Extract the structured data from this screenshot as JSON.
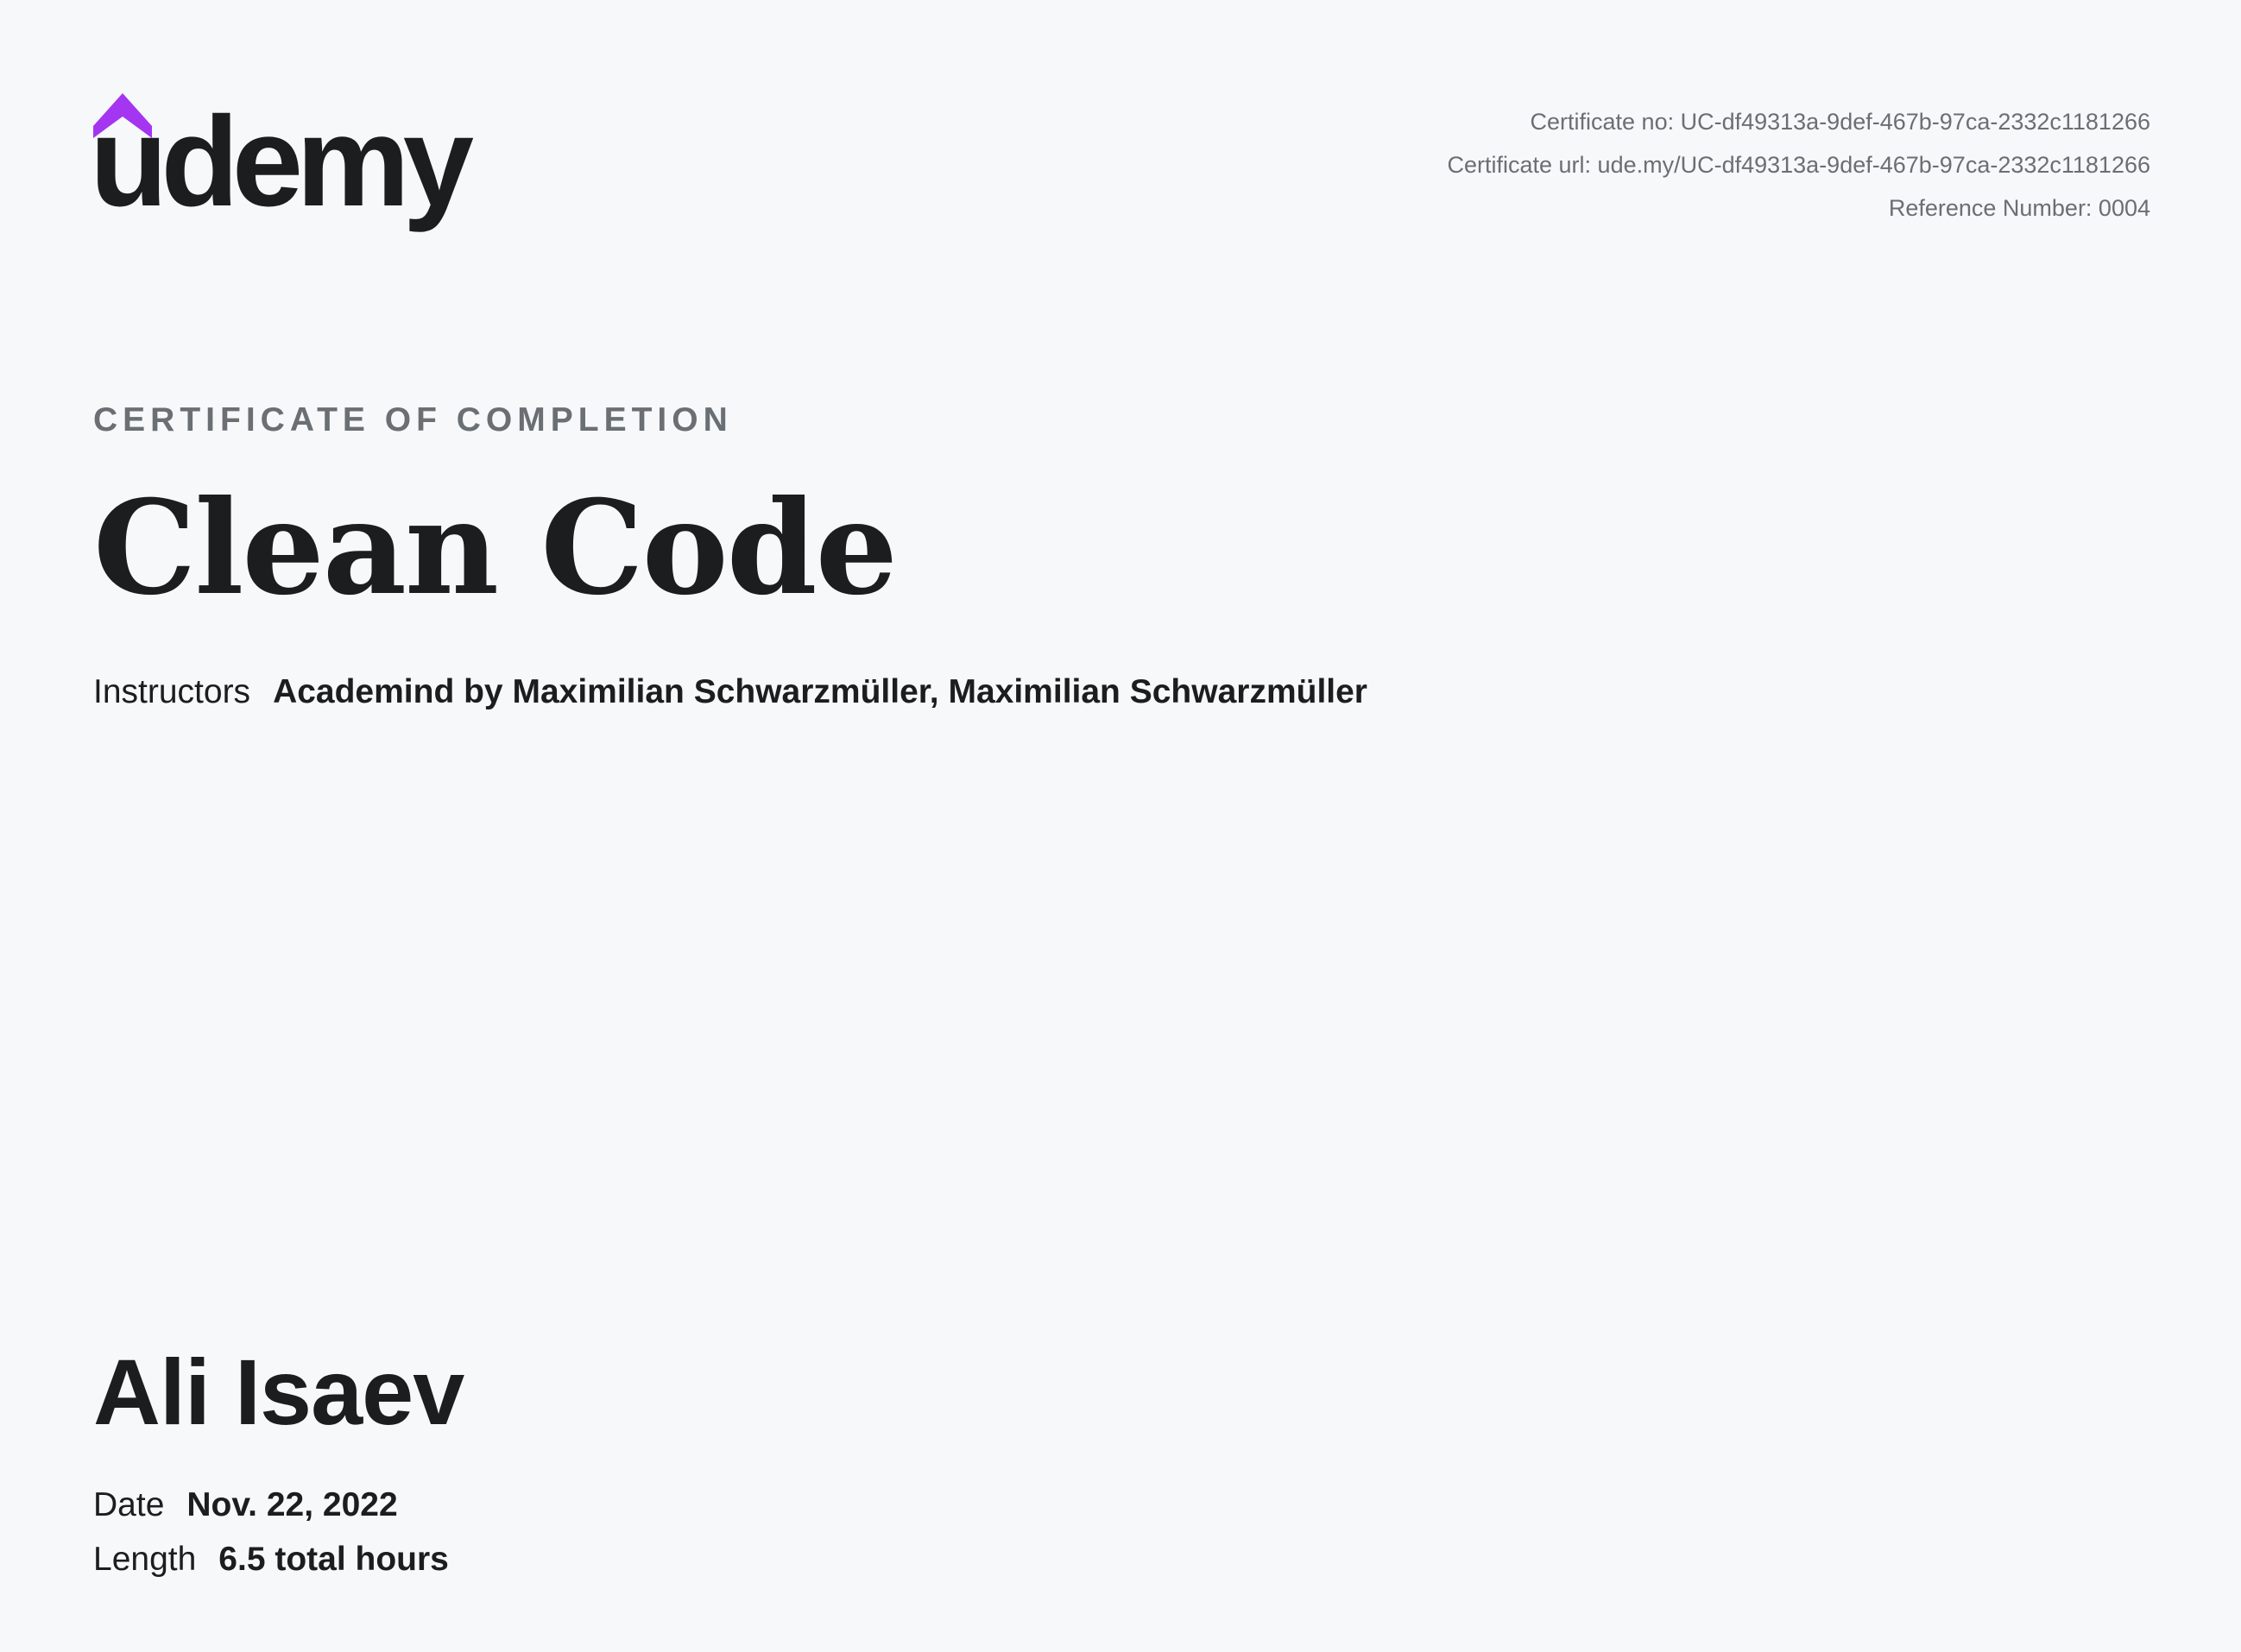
{
  "brand": {
    "logo_text": "udemy",
    "accent_color": "#a435f0",
    "text_color": "#1c1d1f"
  },
  "certificate_meta": {
    "number": "Certificate no: UC-df49313a-9def-467b-97ca-2332c1181266",
    "url": "Certificate url: ude.my/UC-df49313a-9def-467b-97ca-2332c1181266",
    "reference": "Reference Number: 0004"
  },
  "certificate": {
    "kicker": "CERTIFICATE OF COMPLETION",
    "course_title": "Clean Code",
    "instructors_label": "Instructors",
    "instructors": "Academind by Maximilian Schwarzmüller,  Maximilian Schwarzmüller",
    "recipient": "Ali Isaev",
    "date_label": "Date",
    "date_value": "Nov. 22, 2022",
    "length_label": "Length",
    "length_value": "6.5 total hours"
  }
}
